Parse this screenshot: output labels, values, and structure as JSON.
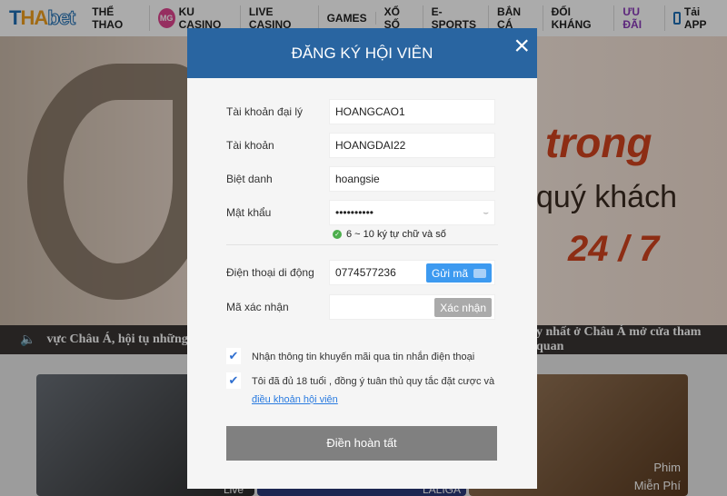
{
  "nav": {
    "logo": "THAbet",
    "items": [
      "THỂ THAO",
      "KU CASINO",
      "LIVE CASINO",
      "GAMES",
      "XỔ SỐ",
      "E-SPORTS",
      "BẮN CÁ",
      "ĐỐI KHÁNG",
      "ƯU ĐÃI",
      "Tải APP"
    ],
    "mg_badge": "MG",
    "highlight_color": "#8a3ab9"
  },
  "banner": {
    "line1": "trong",
    "line2": "quý khách",
    "line3": "24 / 7"
  },
  "ticker": {
    "left": "vực Châu Á, hội tụ những Dea",
    "right": "y nhất ở Châu Á mở cửa tham quan"
  },
  "cards": {
    "c2": "Live",
    "c3": "LALIGA",
    "c4a": "Phim",
    "c4b": "Miễn Phí"
  },
  "modal": {
    "title": "ĐĂNG KÝ HỘI VIÊN",
    "close": "×",
    "fields": [
      {
        "label": "Tài khoản đại lý",
        "value": "HOANGCAO1"
      },
      {
        "label": "Tài khoản",
        "value": "HOANGDAI22"
      },
      {
        "label": "Biệt danh",
        "value": "hoangsie"
      },
      {
        "label": "Mật khẩu",
        "value": "••••••••••"
      }
    ],
    "password_hint": "6 ~ 10 ký tự chữ và số",
    "phone": {
      "label": "Điện thoại di động",
      "value": "0774577236",
      "button": "Gửi mã"
    },
    "code": {
      "label": "Mã xác nhận",
      "value": "",
      "button": "Xác nhận"
    },
    "check1": {
      "checked": true,
      "text": "Nhận thông tin khuyến mãi qua tin nhắn điện thoại"
    },
    "check2": {
      "checked": true,
      "text": "Tôi đã đủ 18 tuổi , đồng ý tuân thủ quy tắc đặt cược và",
      "link": "điều khoản hội viên"
    },
    "submit": "Điền hoàn tất"
  }
}
